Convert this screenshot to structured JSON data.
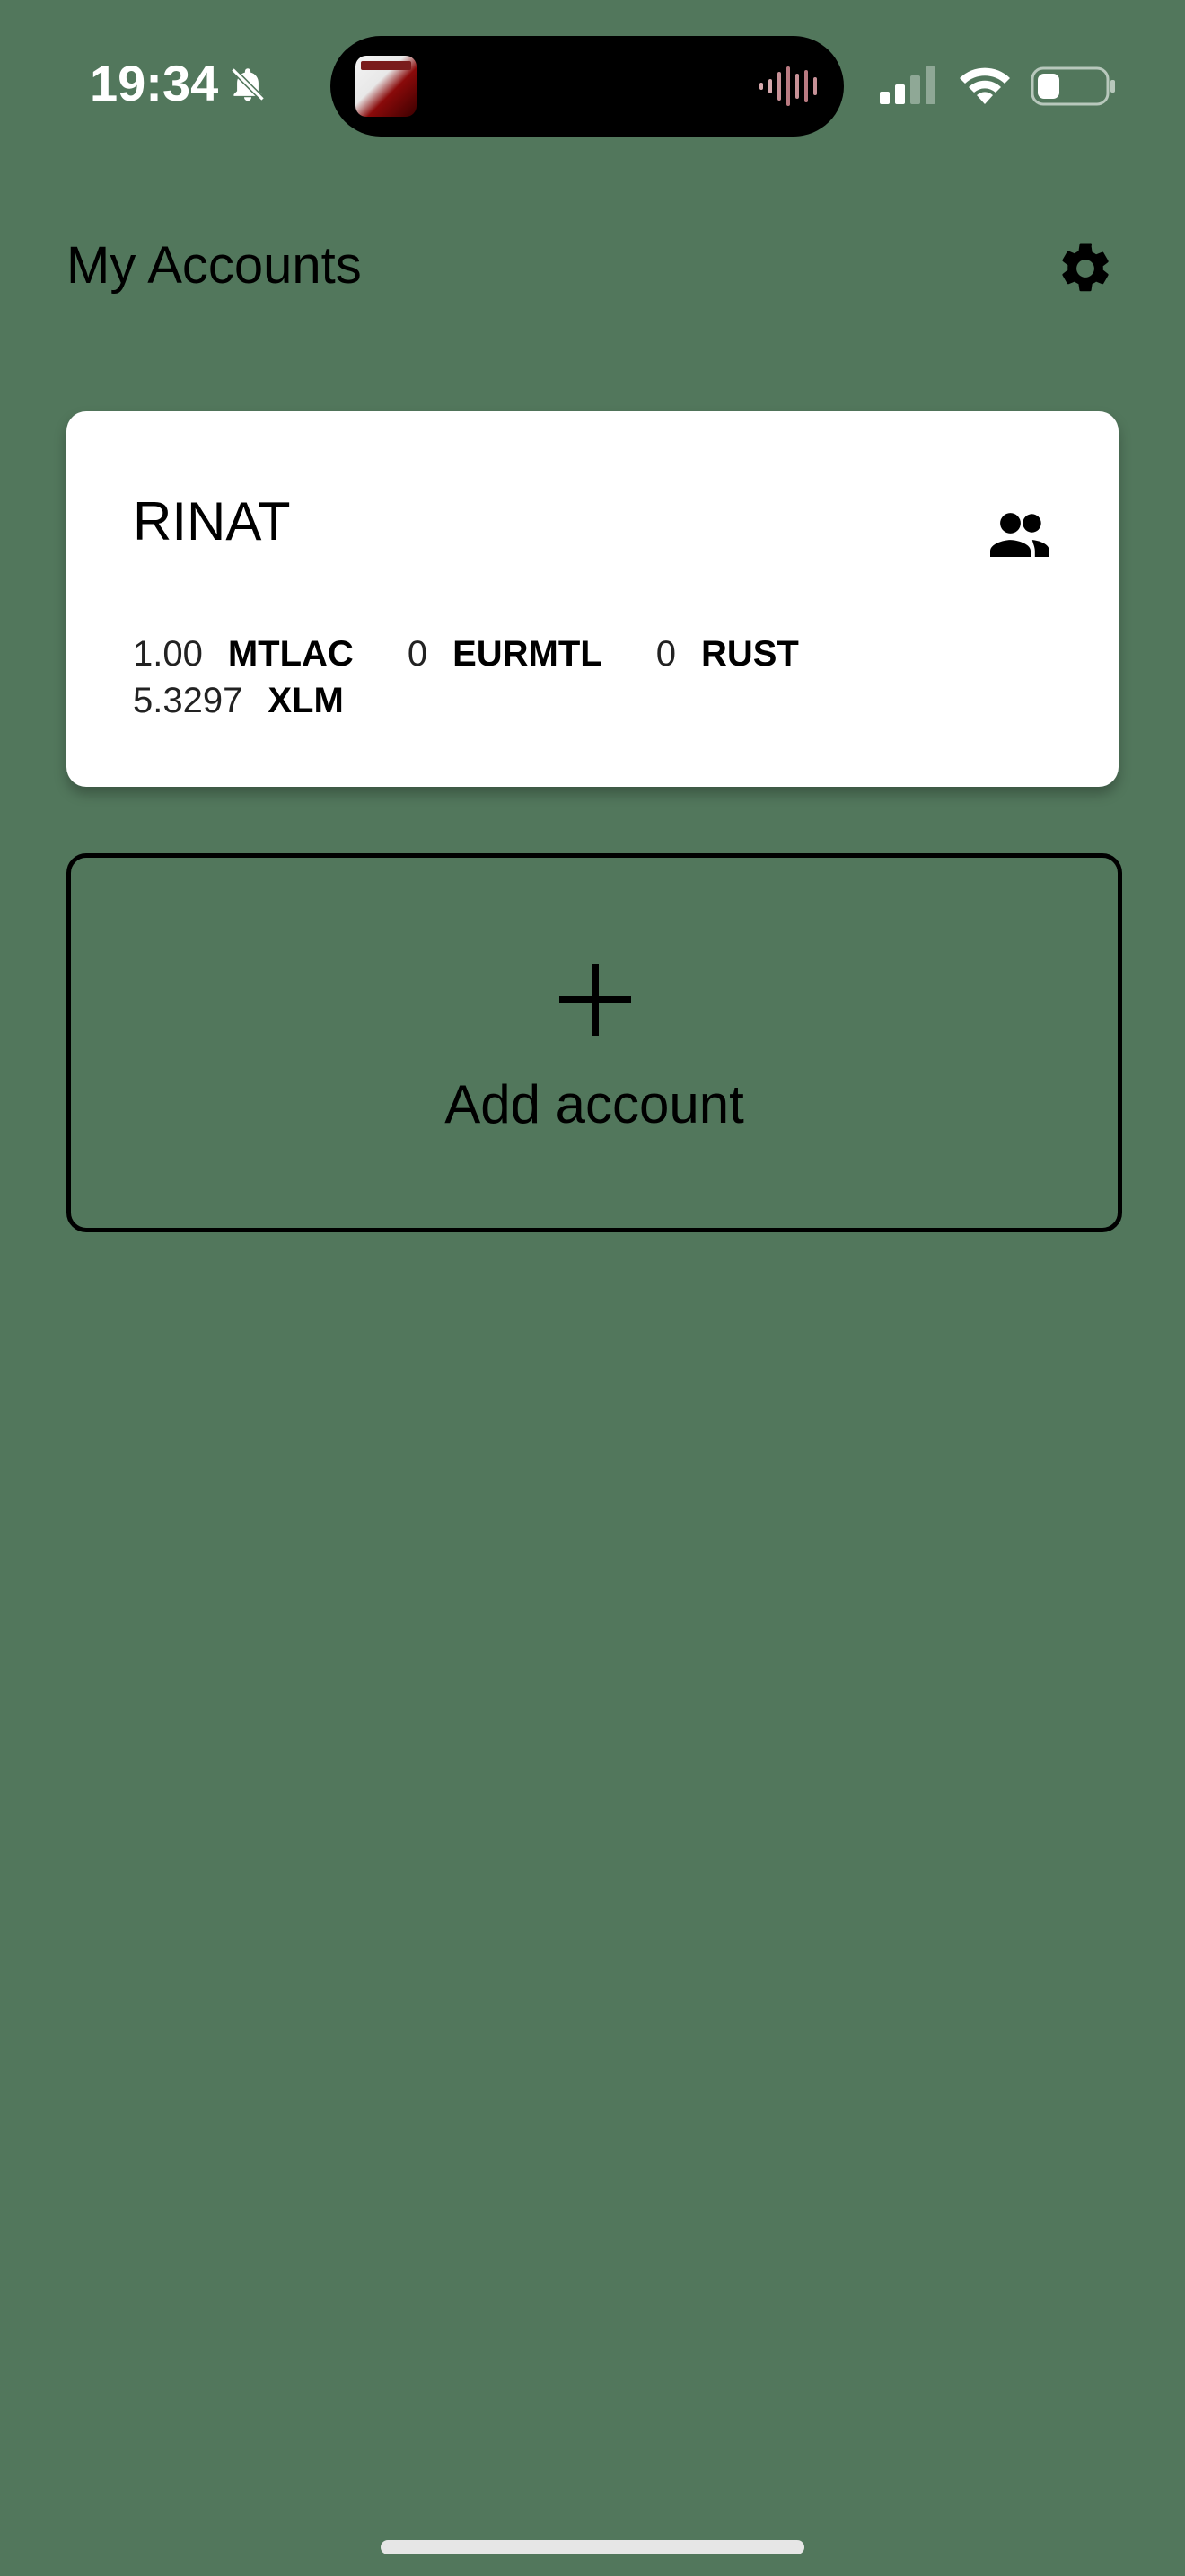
{
  "status_bar": {
    "time": "19:34",
    "icons": [
      "bell-off-icon",
      "waveform-icon",
      "cellular-icon",
      "wifi-icon",
      "battery-icon"
    ]
  },
  "header": {
    "title": "My Accounts",
    "settings_icon": "gear-icon"
  },
  "accounts": [
    {
      "name": "RINAT",
      "shared_icon": "people-icon",
      "balances": [
        {
          "amount": "1.00",
          "code": "MTLAC"
        },
        {
          "amount": "0",
          "code": "EURMTL"
        },
        {
          "amount": "0",
          "code": "RUST"
        },
        {
          "amount": "5.3297",
          "code": "XLM"
        }
      ]
    }
  ],
  "add_account": {
    "label": "Add account",
    "icon": "plus-icon"
  },
  "colors": {
    "background": "#52775c",
    "card": "#ffffff",
    "text": "#000000"
  }
}
